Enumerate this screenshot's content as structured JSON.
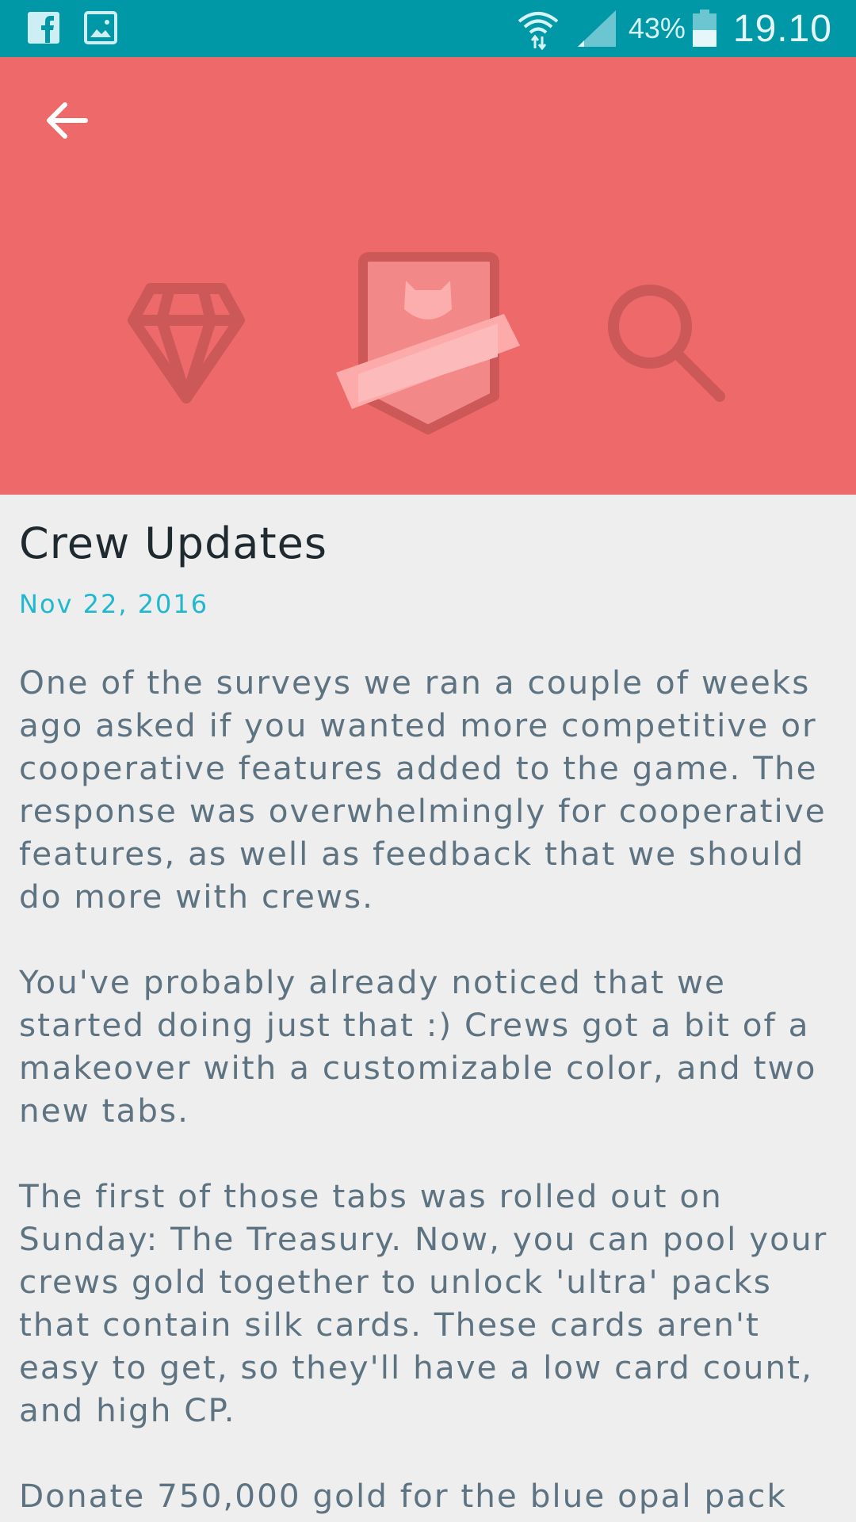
{
  "status_bar": {
    "battery_percent": "43%",
    "time": "19.10",
    "icons": [
      "facebook-icon",
      "image-icon",
      "wifi-icon",
      "signal-icon",
      "battery-icon"
    ],
    "background_color": "#0097a7"
  },
  "hero": {
    "background_color": "#ee6a6a",
    "icons": [
      "diamond-icon",
      "crew-badge-icon",
      "search-icon"
    ]
  },
  "article": {
    "title": "Crew Updates",
    "date": "Nov 22, 2016",
    "paragraphs": [
      "One of the surveys we ran a couple of weeks ago asked if you wanted more competitive or cooperative features added to the game. The response was overwhelmingly for cooperative features, as well as feedback that we should do more with crews.",
      "You've probably already noticed that we started doing just that :) Crews got a bit of a makeover with a customizable color, and two new tabs.",
      "The first of those tabs was rolled out on Sunday: The Treasury. Now, you can pool your crews gold together to unlock 'ultra' packs that contain silk cards. These cards aren't easy to get, so they'll have a low card count, and high CP.",
      "Donate 750,000 gold for the blue opal pack"
    ]
  }
}
